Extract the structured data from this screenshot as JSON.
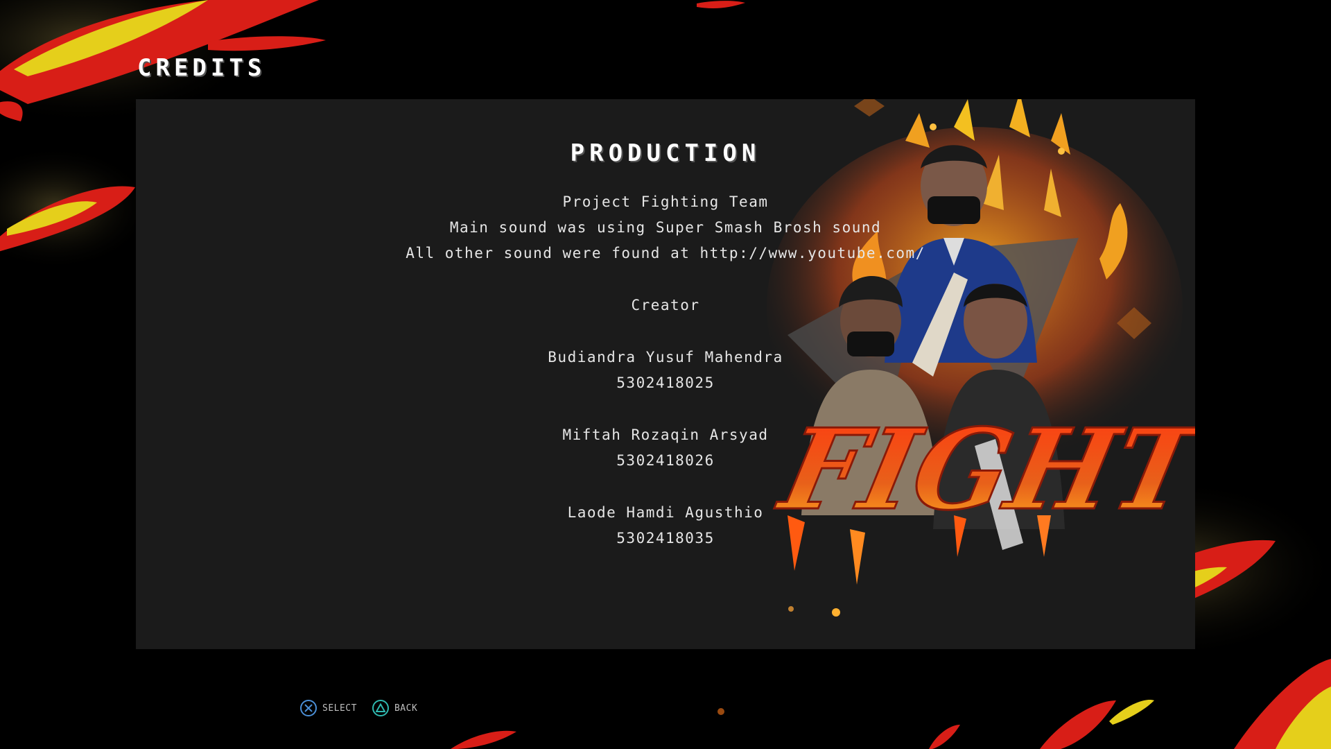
{
  "screen": {
    "title": "CREDITS"
  },
  "credits": {
    "section_title": "PRODUCTION",
    "team": "Project Fighting Team",
    "sound_note_1": "Main sound was using Super Smash Brosh sound",
    "sound_note_2": "All other sound were found at http://www.youtube.com/",
    "creator_heading": "Creator",
    "creators": [
      {
        "name": "Budiandra Yusuf Mahendra",
        "id": "5302418025"
      },
      {
        "name": "Miftah Rozaqin Arsyad",
        "id": "5302418026"
      },
      {
        "name": "Laode Hamdi Agusthio",
        "id": "5302418035"
      }
    ]
  },
  "artwork": {
    "logo_text": "FIGHT"
  },
  "footer": {
    "select": {
      "icon": "cross-button-icon",
      "label": "SELECT"
    },
    "back": {
      "icon": "triangle-button-icon",
      "label": "BACK"
    }
  },
  "colors": {
    "background": "#000000",
    "panel": "#1b1b1b",
    "flame_red": "#d8201a",
    "flame_yellow": "#e9d21a",
    "cross_blue": "#4b8fd6",
    "triangle_teal": "#2fb9b0"
  }
}
